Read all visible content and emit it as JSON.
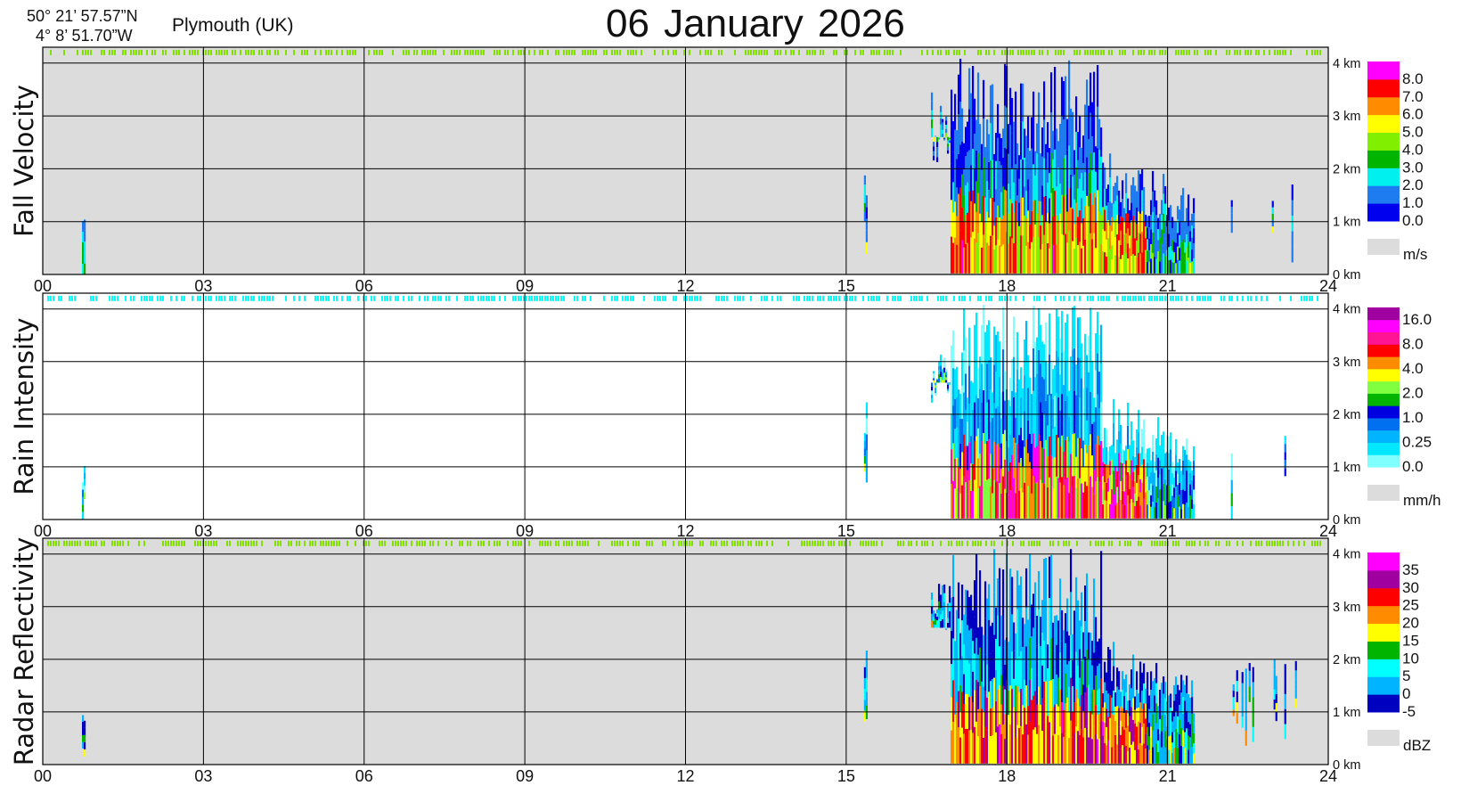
{
  "header": {
    "latitude": "50° 21’ 57.57”N",
    "longitude": "4°  8’ 51.70”W",
    "station": "Plymouth (UK)",
    "title": "06 January  2026"
  },
  "x_ticks": [
    "00",
    "03",
    "06",
    "09",
    "12",
    "15",
    "18",
    "21",
    "24"
  ],
  "y_ticks": [
    "0 km",
    "1 km",
    "2 km",
    "3 km",
    "4 km"
  ],
  "panels": [
    {
      "label": "Fall Velocity",
      "unit": "m/s",
      "background": "#dcdcdc",
      "colorbar": [
        {
          "color": "#0000ee",
          "label": "0.0"
        },
        {
          "color": "#1e7cf0",
          "label": "1.0"
        },
        {
          "color": "#00f0f0",
          "label": "2.0"
        },
        {
          "color": "#00b400",
          "label": "3.0"
        },
        {
          "color": "#80f000",
          "label": "4.0"
        },
        {
          "color": "#ffff00",
          "label": "5.0"
        },
        {
          "color": "#ff8c00",
          "label": "6.0"
        },
        {
          "color": "#ff0000",
          "label": "7.0"
        },
        {
          "color": "#ff00ff",
          "label": "8.0"
        }
      ]
    },
    {
      "label": "Rain Intensity",
      "unit": "mm/h",
      "background": "#ffffff",
      "colorbar": [
        {
          "color": "#80ffff",
          "label": "0.0"
        },
        {
          "color": "#00e8ff",
          "label": ""
        },
        {
          "color": "#00b4ff",
          "label": "0.25"
        },
        {
          "color": "#0070f0",
          "label": ""
        },
        {
          "color": "#0000e0",
          "label": "1.0"
        },
        {
          "color": "#00b400",
          "label": ""
        },
        {
          "color": "#80ff40",
          "label": "2.0"
        },
        {
          "color": "#ffff00",
          "label": ""
        },
        {
          "color": "#ff8c00",
          "label": "4.0"
        },
        {
          "color": "#ff0000",
          "label": ""
        },
        {
          "color": "#ff1493",
          "label": "8.0"
        },
        {
          "color": "#ff00ff",
          "label": ""
        },
        {
          "color": "#a000a0",
          "label": "16.0"
        }
      ]
    },
    {
      "label": "Radar Reflectivity",
      "unit": "dBZ",
      "background": "#dcdcdc",
      "colorbar": [
        {
          "color": "#0000c0",
          "label": "-5"
        },
        {
          "color": "#00b4ff",
          "label": "0"
        },
        {
          "color": "#00ffff",
          "label": "5"
        },
        {
          "color": "#00b400",
          "label": "10"
        },
        {
          "color": "#ffff00",
          "label": "15"
        },
        {
          "color": "#ff8c00",
          "label": "20"
        },
        {
          "color": "#ff0000",
          "label": "25"
        },
        {
          "color": "#a000a0",
          "label": "30"
        },
        {
          "color": "#ff00ff",
          "label": "35"
        }
      ]
    }
  ],
  "chart_data": {
    "type": "heatmap",
    "x_axis": {
      "quantity": "hour (UTC)",
      "range": [
        0,
        24
      ]
    },
    "y_axis": {
      "quantity": "height (km)",
      "range": [
        0,
        4.3
      ]
    },
    "grid": true,
    "events": [
      {
        "description": "main precipitation event",
        "start_hour": 16.6,
        "end_hour": 21.5,
        "max_height_km": 4.1,
        "bright_band_km": 0.6
      },
      {
        "description": "isolated echo",
        "start_hour": 15.35,
        "end_hour": 15.4,
        "max_height_km": 2.5
      },
      {
        "description": "isolated echo",
        "start_hour": 0.75,
        "end_hour": 0.8,
        "max_height_km": 1.2
      },
      {
        "description": "trailing showers",
        "start_hour": 22.0,
        "end_hour": 23.95,
        "max_height_km": 2.0
      }
    ]
  }
}
